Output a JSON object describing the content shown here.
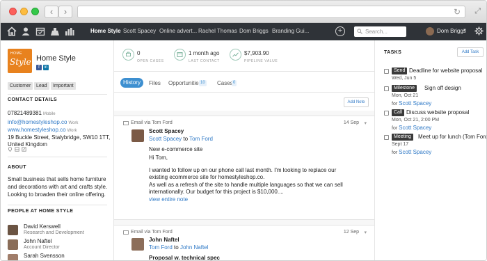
{
  "browser": {
    "url": ""
  },
  "nav": {
    "tabs": [
      "Home Style",
      "Scott Spacey",
      "Online advert...",
      "Rachel Thomas",
      "Dom Briggs",
      "Branding Gui..."
    ],
    "search_placeholder": "Search...",
    "user_name": "Dom Briggs",
    "icons": [
      "home-icon",
      "person-icon",
      "calendar-icon",
      "building-icon",
      "bar-chart-icon"
    ]
  },
  "company": {
    "logo_top": "HOME",
    "logo_main": "Style",
    "name": "Home Style",
    "tags": [
      "Customer",
      "Lead",
      "Important"
    ]
  },
  "contact": {
    "heading": "CONTACT DETAILS",
    "phone": "07821489381",
    "phone_type": "Mobile",
    "email": "info@homestyleshop.co",
    "email_type": "Work",
    "website": "www.homestyleshop.co",
    "website_type": "Work",
    "address_line1": "19 Buckle Street, Stalybridge, SW10 1TT,",
    "address_line2": "United Kingdom"
  },
  "about": {
    "heading": "ABOUT",
    "text": "Small business that sells home furniture and decorations with art and crafts style. Looking to broaden their online offering."
  },
  "people": {
    "heading": "PEOPLE AT HOME STYLE",
    "list": [
      {
        "name": "David Kerswell",
        "role": "Research and Development"
      },
      {
        "name": "John Naftel",
        "role": "Account Director"
      },
      {
        "name": "Sarah Svensson",
        "role": ""
      }
    ]
  },
  "stats": [
    {
      "value": "0",
      "label": "OPEN CASES"
    },
    {
      "value": "1 month ago",
      "label": "LAST CONTACT"
    },
    {
      "value": "$7,903.90",
      "label": "PIPELINE VALUE"
    }
  ],
  "tabs": {
    "history": "History",
    "files": "Files",
    "opportunities": "Opportunities",
    "opportunities_count": "10",
    "cases": "Cases",
    "cases_count": "0",
    "add_note": "Add Note"
  },
  "emails": [
    {
      "via": "Email via Tom Ford",
      "date": "14 Sep",
      "sender": "Scott Spacey",
      "from": "Scott Spacey",
      "to_word": "to",
      "to": "Tom Ford",
      "subject": "New e-commerce site",
      "greeting": "Hi Tom,",
      "body1": "I wanted to follow up on our phone call last month. I'm looking to replace our existing ecommerce site for homestyleshop.co.",
      "body2": "As well as a refresh of the site to handle multiple languages so that we can sell internationally. Our budget for this project is $10,000....",
      "view_link": "view entire note"
    },
    {
      "via": "Email via Tom Ford",
      "date": "12 Sep",
      "sender": "John Naftel",
      "from": "Tom Ford",
      "to_word": "to",
      "to": "John Naftel",
      "subject": "Proposal w. technical spec"
    }
  ],
  "tasks": {
    "heading": "TASKS",
    "add_label": "Add Task",
    "items": [
      {
        "category": "Send",
        "title": "Deadline for website proposal",
        "date": "Wed, Jun 5",
        "for_label": "",
        "for_name": ""
      },
      {
        "category": "Milestone",
        "title": "Sign off design",
        "date": "Mon, Oct 21",
        "for_label": "for",
        "for_name": "Scott Spacey"
      },
      {
        "category": "Call",
        "title": "Discuss website proposal",
        "date": "Mon, Oct 21, 2:00 PM",
        "for_label": "for",
        "for_name": "Scott Spacey"
      },
      {
        "category": "Meeting",
        "title": "Meet up for lunch (Tom Ford)",
        "date": "Sept 17",
        "for_label": "for",
        "for_name": "Scott Spacey"
      }
    ]
  },
  "colors": {
    "nav_bg": "#2f3338",
    "accent": "#3d8fd0",
    "link": "#2f79c6",
    "logo": "#e8821e"
  }
}
